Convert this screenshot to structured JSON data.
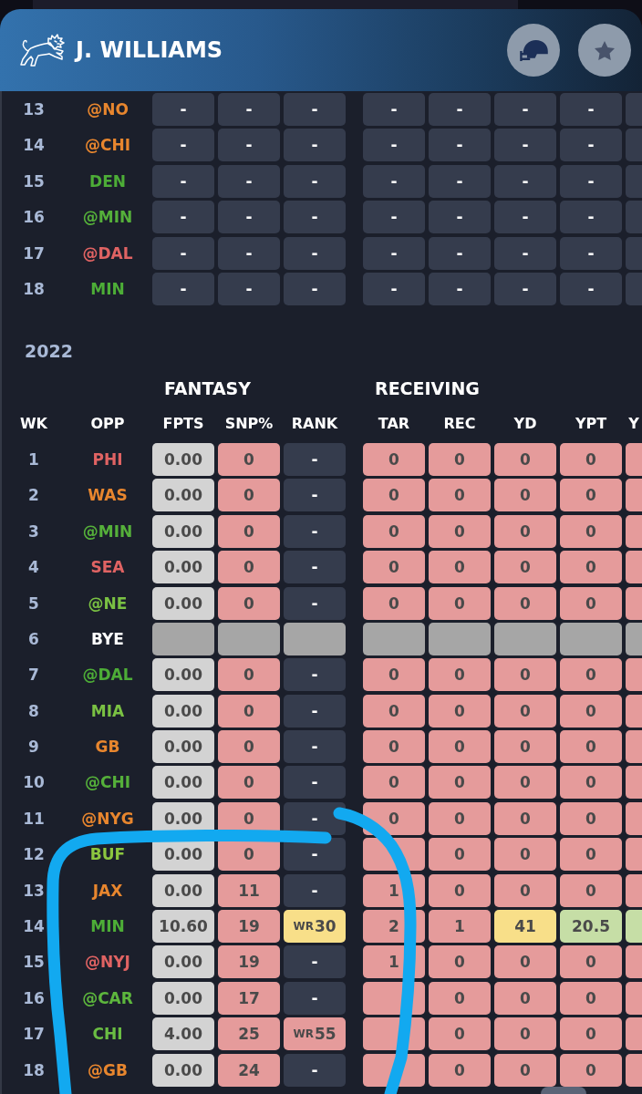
{
  "header": {
    "player_name": "J. WILLIAMS"
  },
  "upper_season": {
    "rows": [
      {
        "week": "13",
        "opponent": {
          "text": "@NO",
          "color": "#e8862e"
        },
        "stats": [
          [
            {
              "value": "-",
              "color": "#353c4d"
            },
            {
              "value": "-",
              "color": "#353c4d"
            },
            {
              "value": "-",
              "color": "#353c4d"
            }
          ],
          [
            {
              "value": "-",
              "color": "#353c4d"
            },
            {
              "value": "-",
              "color": "#353c4d"
            },
            {
              "value": "-",
              "color": "#353c4d"
            },
            {
              "value": "-",
              "color": "#353c4d"
            },
            {
              "color": "#353c4d"
            }
          ]
        ]
      },
      {
        "week": "14",
        "opponent": {
          "text": "@CHI",
          "color": "#e8862e"
        },
        "stats": [
          [
            {
              "value": "-",
              "color": "#353c4d"
            },
            {
              "value": "-",
              "color": "#353c4d"
            },
            {
              "value": "-",
              "color": "#353c4d"
            }
          ],
          [
            {
              "value": "-",
              "color": "#353c4d"
            },
            {
              "value": "-",
              "color": "#353c4d"
            },
            {
              "value": "-",
              "color": "#353c4d"
            },
            {
              "value": "-",
              "color": "#353c4d"
            },
            {
              "color": "#353c4d"
            }
          ]
        ]
      },
      {
        "week": "15",
        "opponent": {
          "text": "DEN",
          "color": "#4dad37"
        },
        "stats": [
          [
            {
              "value": "-",
              "color": "#353c4d"
            },
            {
              "value": "-",
              "color": "#353c4d"
            },
            {
              "value": "-",
              "color": "#353c4d"
            }
          ],
          [
            {
              "value": "-",
              "color": "#353c4d"
            },
            {
              "value": "-",
              "color": "#353c4d"
            },
            {
              "value": "-",
              "color": "#353c4d"
            },
            {
              "value": "-",
              "color": "#353c4d"
            },
            {
              "color": "#353c4d"
            }
          ]
        ]
      },
      {
        "week": "16",
        "opponent": {
          "text": "@MIN",
          "color": "#55b03a"
        },
        "stats": [
          [
            {
              "value": "-",
              "color": "#353c4d"
            },
            {
              "value": "-",
              "color": "#353c4d"
            },
            {
              "value": "-",
              "color": "#353c4d"
            }
          ],
          [
            {
              "value": "-",
              "color": "#353c4d"
            },
            {
              "value": "-",
              "color": "#353c4d"
            },
            {
              "value": "-",
              "color": "#353c4d"
            },
            {
              "value": "-",
              "color": "#353c4d"
            },
            {
              "color": "#353c4d"
            }
          ]
        ]
      },
      {
        "week": "17",
        "opponent": {
          "text": "@DAL",
          "color": "#e06363"
        },
        "stats": [
          [
            {
              "value": "-",
              "color": "#353c4d"
            },
            {
              "value": "-",
              "color": "#353c4d"
            },
            {
              "value": "-",
              "color": "#353c4d"
            }
          ],
          [
            {
              "value": "-",
              "color": "#353c4d"
            },
            {
              "value": "-",
              "color": "#353c4d"
            },
            {
              "value": "-",
              "color": "#353c4d"
            },
            {
              "value": "-",
              "color": "#353c4d"
            },
            {
              "color": "#353c4d"
            }
          ]
        ]
      },
      {
        "week": "18",
        "opponent": {
          "text": "MIN",
          "color": "#4dad37"
        },
        "stats": [
          [
            {
              "value": "-",
              "color": "#353c4d"
            },
            {
              "value": "-",
              "color": "#353c4d"
            },
            {
              "value": "-",
              "color": "#353c4d"
            }
          ],
          [
            {
              "value": "-",
              "color": "#353c4d"
            },
            {
              "value": "-",
              "color": "#353c4d"
            },
            {
              "value": "-",
              "color": "#353c4d"
            },
            {
              "value": "-",
              "color": "#353c4d"
            },
            {
              "color": "#353c4d"
            }
          ]
        ]
      }
    ]
  },
  "season": {
    "year": "2022",
    "lead_columns": [
      "WK",
      "OPP"
    ],
    "groups": [
      {
        "label": "FANTASY",
        "columns": [
          "FPTS",
          "SNP%",
          "RANK"
        ]
      },
      {
        "label": "RECEIVING",
        "columns": [
          "TAR",
          "REC",
          "YD",
          "YPT",
          "Y"
        ]
      }
    ],
    "rows": [
      {
        "week": "1",
        "opponent": {
          "text": "PHI",
          "color": "#e06363"
        },
        "stats": [
          [
            {
              "value": "0.00",
              "color": "#d3d3d3"
            },
            {
              "value": "0",
              "color": "#e59b9b"
            },
            {
              "value": "-",
              "color": "#353c4d"
            }
          ],
          [
            {
              "value": "0",
              "color": "#e59b9b"
            },
            {
              "value": "0",
              "color": "#e59b9b"
            },
            {
              "value": "0",
              "color": "#e59b9b"
            },
            {
              "value": "0",
              "color": "#e59b9b"
            },
            {
              "color": "#e59b9b"
            }
          ]
        ]
      },
      {
        "week": "2",
        "opponent": {
          "text": "WAS",
          "color": "#e8862e"
        },
        "stats": [
          [
            {
              "value": "0.00",
              "color": "#d3d3d3"
            },
            {
              "value": "0",
              "color": "#e59b9b"
            },
            {
              "value": "-",
              "color": "#353c4d"
            }
          ],
          [
            {
              "value": "0",
              "color": "#e59b9b"
            },
            {
              "value": "0",
              "color": "#e59b9b"
            },
            {
              "value": "0",
              "color": "#e59b9b"
            },
            {
              "value": "0",
              "color": "#e59b9b"
            },
            {
              "color": "#e59b9b"
            }
          ]
        ]
      },
      {
        "week": "3",
        "opponent": {
          "text": "@MIN",
          "color": "#55b03a"
        },
        "stats": [
          [
            {
              "value": "0.00",
              "color": "#d3d3d3"
            },
            {
              "value": "0",
              "color": "#e59b9b"
            },
            {
              "value": "-",
              "color": "#353c4d"
            }
          ],
          [
            {
              "value": "0",
              "color": "#e59b9b"
            },
            {
              "value": "0",
              "color": "#e59b9b"
            },
            {
              "value": "0",
              "color": "#e59b9b"
            },
            {
              "value": "0",
              "color": "#e59b9b"
            },
            {
              "color": "#e59b9b"
            }
          ]
        ]
      },
      {
        "week": "4",
        "opponent": {
          "text": "SEA",
          "color": "#e06363"
        },
        "stats": [
          [
            {
              "value": "0.00",
              "color": "#d3d3d3"
            },
            {
              "value": "0",
              "color": "#e59b9b"
            },
            {
              "value": "-",
              "color": "#353c4d"
            }
          ],
          [
            {
              "value": "0",
              "color": "#e59b9b"
            },
            {
              "value": "0",
              "color": "#e59b9b"
            },
            {
              "value": "0",
              "color": "#e59b9b"
            },
            {
              "value": "0",
              "color": "#e59b9b"
            },
            {
              "color": "#e59b9b"
            }
          ]
        ]
      },
      {
        "week": "5",
        "opponent": {
          "text": "@NE",
          "color": "#7ac143"
        },
        "stats": [
          [
            {
              "value": "0.00",
              "color": "#d3d3d3"
            },
            {
              "value": "0",
              "color": "#e59b9b"
            },
            {
              "value": "-",
              "color": "#353c4d"
            }
          ],
          [
            {
              "value": "0",
              "color": "#e59b9b"
            },
            {
              "value": "0",
              "color": "#e59b9b"
            },
            {
              "value": "0",
              "color": "#e59b9b"
            },
            {
              "value": "0",
              "color": "#e59b9b"
            },
            {
              "color": "#e59b9b"
            }
          ]
        ]
      },
      {
        "week": "6",
        "opponent": {
          "text": "BYE",
          "color": "#ffffff"
        },
        "stats": [
          [
            {
              "color": "#a6a6a6"
            },
            {
              "color": "#a6a6a6"
            },
            {
              "color": "#a6a6a6"
            }
          ],
          [
            {
              "color": "#a6a6a6"
            },
            {
              "color": "#a6a6a6"
            },
            {
              "color": "#a6a6a6"
            },
            {
              "color": "#a6a6a6"
            },
            {
              "color": "#a6a6a6"
            }
          ]
        ]
      },
      {
        "week": "7",
        "opponent": {
          "text": "@DAL",
          "color": "#4dad37"
        },
        "stats": [
          [
            {
              "value": "0.00",
              "color": "#d3d3d3"
            },
            {
              "value": "0",
              "color": "#e59b9b"
            },
            {
              "value": "-",
              "color": "#353c4d"
            }
          ],
          [
            {
              "value": "0",
              "color": "#e59b9b"
            },
            {
              "value": "0",
              "color": "#e59b9b"
            },
            {
              "value": "0",
              "color": "#e59b9b"
            },
            {
              "value": "0",
              "color": "#e59b9b"
            },
            {
              "color": "#e59b9b"
            }
          ]
        ]
      },
      {
        "week": "8",
        "opponent": {
          "text": "MIA",
          "color": "#7ac143"
        },
        "stats": [
          [
            {
              "value": "0.00",
              "color": "#d3d3d3"
            },
            {
              "value": "0",
              "color": "#e59b9b"
            },
            {
              "value": "-",
              "color": "#353c4d"
            }
          ],
          [
            {
              "value": "0",
              "color": "#e59b9b"
            },
            {
              "value": "0",
              "color": "#e59b9b"
            },
            {
              "value": "0",
              "color": "#e59b9b"
            },
            {
              "value": "0",
              "color": "#e59b9b"
            },
            {
              "color": "#e59b9b"
            }
          ]
        ]
      },
      {
        "week": "9",
        "opponent": {
          "text": "GB",
          "color": "#e8862e"
        },
        "stats": [
          [
            {
              "value": "0.00",
              "color": "#d3d3d3"
            },
            {
              "value": "0",
              "color": "#e59b9b"
            },
            {
              "value": "-",
              "color": "#353c4d"
            }
          ],
          [
            {
              "value": "0",
              "color": "#e59b9b"
            },
            {
              "value": "0",
              "color": "#e59b9b"
            },
            {
              "value": "0",
              "color": "#e59b9b"
            },
            {
              "value": "0",
              "color": "#e59b9b"
            },
            {
              "color": "#e59b9b"
            }
          ]
        ]
      },
      {
        "week": "10",
        "opponent": {
          "text": "@CHI",
          "color": "#55b03a"
        },
        "stats": [
          [
            {
              "value": "0.00",
              "color": "#d3d3d3"
            },
            {
              "value": "0",
              "color": "#e59b9b"
            },
            {
              "value": "-",
              "color": "#353c4d"
            }
          ],
          [
            {
              "value": "0",
              "color": "#e59b9b"
            },
            {
              "value": "0",
              "color": "#e59b9b"
            },
            {
              "value": "0",
              "color": "#e59b9b"
            },
            {
              "value": "0",
              "color": "#e59b9b"
            },
            {
              "color": "#e59b9b"
            }
          ]
        ]
      },
      {
        "week": "11",
        "opponent": {
          "text": "@NYG",
          "color": "#e8862e"
        },
        "stats": [
          [
            {
              "value": "0.00",
              "color": "#d3d3d3"
            },
            {
              "value": "0",
              "color": "#e59b9b"
            },
            {
              "value": "-",
              "color": "#353c4d"
            }
          ],
          [
            {
              "value": "0",
              "color": "#e59b9b"
            },
            {
              "value": "0",
              "color": "#e59b9b"
            },
            {
              "value": "0",
              "color": "#e59b9b"
            },
            {
              "value": "0",
              "color": "#e59b9b"
            },
            {
              "color": "#e59b9b"
            }
          ]
        ]
      },
      {
        "week": "12",
        "opponent": {
          "text": "BUF",
          "color": "#8cc63f"
        },
        "stats": [
          [
            {
              "value": "0.00",
              "color": "#d3d3d3"
            },
            {
              "value": "0",
              "color": "#e59b9b"
            },
            {
              "value": "-",
              "color": "#353c4d"
            }
          ],
          [
            {
              "color": "#e59b9b"
            },
            {
              "value": "0",
              "color": "#e59b9b"
            },
            {
              "value": "0",
              "color": "#e59b9b"
            },
            {
              "value": "0",
              "color": "#e59b9b"
            },
            {
              "color": "#e59b9b"
            }
          ]
        ]
      },
      {
        "week": "13",
        "opponent": {
          "text": "JAX",
          "color": "#e8862e"
        },
        "stats": [
          [
            {
              "value": "0.00",
              "color": "#d3d3d3"
            },
            {
              "value": "11",
              "color": "#e59b9b"
            },
            {
              "value": "-",
              "color": "#353c4d"
            }
          ],
          [
            {
              "value": "1",
              "color": "#e59b9b"
            },
            {
              "value": "0",
              "color": "#e59b9b"
            },
            {
              "value": "0",
              "color": "#e59b9b"
            },
            {
              "value": "0",
              "color": "#e59b9b"
            },
            {
              "color": "#e59b9b"
            }
          ]
        ]
      },
      {
        "week": "14",
        "opponent": {
          "text": "MIN",
          "color": "#4dad37"
        },
        "stats": [
          [
            {
              "value": "10.60",
              "color": "#d3d3d3"
            },
            {
              "value": "19",
              "color": "#e59b9b"
            },
            {
              "prefix": "WR",
              "value": "30",
              "color": "#f8df89"
            }
          ],
          [
            {
              "value": "2",
              "color": "#e59b9b"
            },
            {
              "value": "1",
              "color": "#e59b9b"
            },
            {
              "value": "41",
              "color": "#f8df89"
            },
            {
              "value": "20.5",
              "color": "#c6dea6"
            },
            {
              "color": "#c6dea6"
            }
          ]
        ]
      },
      {
        "week": "15",
        "opponent": {
          "text": "@NYJ",
          "color": "#e06363"
        },
        "stats": [
          [
            {
              "value": "0.00",
              "color": "#d3d3d3"
            },
            {
              "value": "19",
              "color": "#e59b9b"
            },
            {
              "value": "-",
              "color": "#353c4d"
            }
          ],
          [
            {
              "value": "1",
              "color": "#e59b9b"
            },
            {
              "value": "0",
              "color": "#e59b9b"
            },
            {
              "value": "0",
              "color": "#e59b9b"
            },
            {
              "value": "0",
              "color": "#e59b9b"
            },
            {
              "color": "#e59b9b"
            }
          ]
        ]
      },
      {
        "week": "16",
        "opponent": {
          "text": "@CAR",
          "color": "#5db63d"
        },
        "stats": [
          [
            {
              "value": "0.00",
              "color": "#d3d3d3"
            },
            {
              "value": "17",
              "color": "#e59b9b"
            },
            {
              "value": "-",
              "color": "#353c4d"
            }
          ],
          [
            {
              "color": "#e59b9b"
            },
            {
              "value": "0",
              "color": "#e59b9b"
            },
            {
              "value": "0",
              "color": "#e59b9b"
            },
            {
              "value": "0",
              "color": "#e59b9b"
            },
            {
              "color": "#e59b9b"
            }
          ]
        ]
      },
      {
        "week": "17",
        "opponent": {
          "text": "CHI",
          "color": "#6abd43"
        },
        "stats": [
          [
            {
              "value": "4.00",
              "color": "#d3d3d3"
            },
            {
              "value": "25",
              "color": "#e59b9b"
            },
            {
              "prefix": "WR",
              "value": "55",
              "color": "#e59b9b"
            }
          ],
          [
            {
              "color": "#e59b9b"
            },
            {
              "value": "0",
              "color": "#e59b9b"
            },
            {
              "value": "0",
              "color": "#e59b9b"
            },
            {
              "value": "0",
              "color": "#e59b9b"
            },
            {
              "color": "#e59b9b"
            }
          ]
        ]
      },
      {
        "week": "18",
        "opponent": {
          "text": "@GB",
          "color": "#e8862e"
        },
        "stats": [
          [
            {
              "value": "0.00",
              "color": "#d3d3d3"
            },
            {
              "value": "24",
              "color": "#e59b9b"
            },
            {
              "value": "-",
              "color": "#353c4d"
            }
          ],
          [
            {
              "color": "#e59b9b"
            },
            {
              "value": "0",
              "color": "#e59b9b"
            },
            {
              "value": "0",
              "color": "#e59b9b"
            },
            {
              "value": "0",
              "color": "#e59b9b"
            },
            {
              "color": "#e59b9b"
            }
          ]
        ]
      }
    ]
  }
}
